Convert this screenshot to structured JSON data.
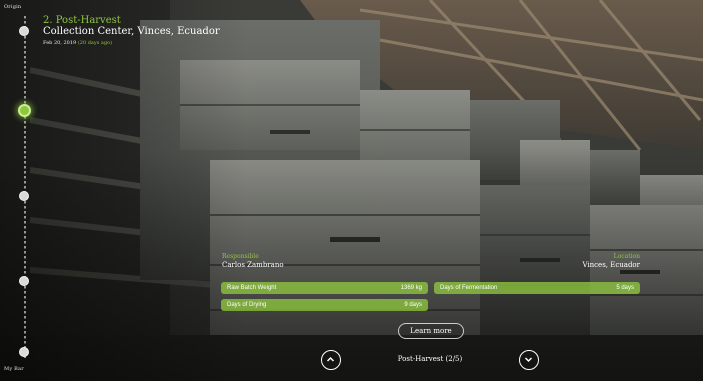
{
  "timeline": {
    "start_label": "Origin",
    "end_label": "My Bar",
    "current_stage_index": 1,
    "stage_count": 5
  },
  "header": {
    "stage_title": "2. Post-Harvest",
    "place": "Collection Center, Vinces, Ecuador",
    "date": "Feb 20, 2019",
    "relative_date": "(20 days ago)"
  },
  "info": {
    "responsible_label": "Responsible",
    "responsible_value": "Carlos Zambrano",
    "location_label": "Location",
    "location_value": "Vinces, Ecuador",
    "metrics": [
      {
        "label": "Raw Batch Weight",
        "value": "1369 kg"
      },
      {
        "label": "Days of Fermentation",
        "value": "5 days"
      },
      {
        "label": "Days of Drying",
        "value": "9 days"
      }
    ],
    "learn_more_label": "Learn more"
  },
  "navigation": {
    "status": "Post-Harvest (2/5)"
  },
  "colors": {
    "accent": "#8ec63f",
    "background": "#2f3230"
  }
}
